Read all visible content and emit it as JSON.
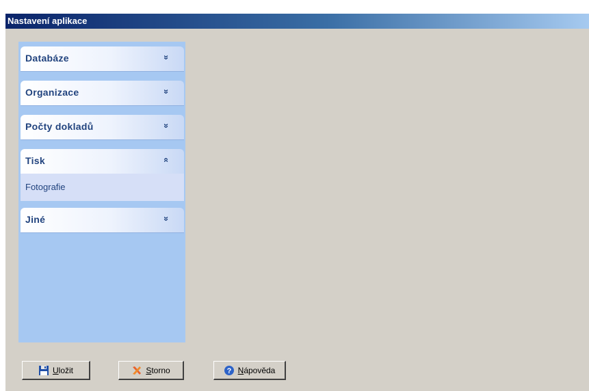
{
  "window": {
    "title": "Nastavení aplikace"
  },
  "sidebar": {
    "groups": [
      {
        "label": "Databáze",
        "chevron": "»",
        "expanded": false
      },
      {
        "label": "Organizace",
        "chevron": "»",
        "expanded": false
      },
      {
        "label": "Počty dokladů",
        "chevron": "»",
        "expanded": false
      },
      {
        "label": "Tisk",
        "chevron": "«",
        "expanded": true,
        "items": [
          "Fotografie"
        ]
      },
      {
        "label": "Jiné",
        "chevron": "»",
        "expanded": false
      }
    ]
  },
  "buttons": {
    "save": {
      "label": "Uložit",
      "icon": "floppy-disk-icon"
    },
    "cancel": {
      "label": "Storno",
      "icon": "cancel-x-icon"
    },
    "help": {
      "label": "Nápověda",
      "icon": "help-icon"
    }
  },
  "colors": {
    "titlebar_start": "#0a246a",
    "sidebar_bg": "#a6c8f2",
    "group_text": "#21437e",
    "window_bg": "#d4d0c8"
  }
}
